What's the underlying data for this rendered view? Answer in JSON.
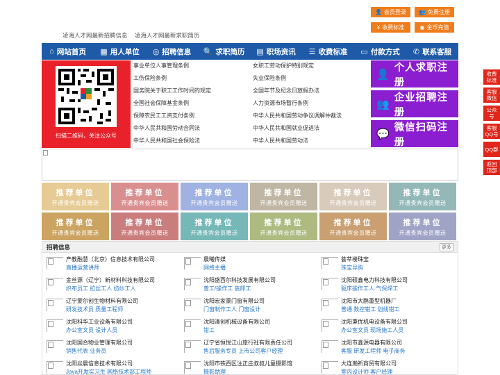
{
  "top_buttons": [
    {
      "label": "会员登录",
      "icon": "user-icon"
    },
    {
      "label": "免费注册",
      "icon": "user-add-icon"
    },
    {
      "label": "收费标准",
      "icon": "yen-icon"
    },
    {
      "label": "金币充值",
      "icon": "coin-icon"
    }
  ],
  "site_links": [
    "凌海人才网最新招聘信息",
    "凌海人才网最新求职简历"
  ],
  "nav": [
    {
      "label": "网站首页",
      "icon": "home-icon"
    },
    {
      "label": "用人单位",
      "icon": "building-icon"
    },
    {
      "label": "招聘信息",
      "icon": "recruit-icon"
    },
    {
      "label": "求职简历",
      "icon": "resume-icon"
    },
    {
      "label": "职场资讯",
      "icon": "news-icon"
    },
    {
      "label": "收费标准",
      "icon": "fee-icon"
    },
    {
      "label": "付款方式",
      "icon": "payment-icon"
    },
    {
      "label": "联系客服",
      "icon": "phone-icon"
    }
  ],
  "qr_caption": "扫描二维码，关注公众号",
  "policy_links": [
    "事业单位人事管理条例",
    "女职工劳动保护特别规定",
    "工伤保险条例",
    "失业保险条例",
    "国务院关于职工工作时间的规定",
    "全国年节及纪念日放假办法",
    "全国社会保障基金条例",
    "人力资源市场暂行条例",
    "保障农民工工资支付条例",
    "中华人民共和国劳动争议调解仲裁法",
    "中华人民共和国劳动合同法",
    "中华人民共和国就业促进法",
    "中华人民共和国社会保险法",
    "中华人民共和国劳动法"
  ],
  "register": [
    {
      "label": "个人求职注册",
      "icon": "person-icon"
    },
    {
      "label": "企业招聘注册",
      "icon": "company-icon"
    },
    {
      "label": "微信扫码注册",
      "icon": "wechat-icon"
    }
  ],
  "recommend": {
    "title": "推荐单位",
    "subtitle": "开通贵宾会员赠送",
    "colors": [
      "#e6c98f",
      "#d78a8a",
      "#9aaee0",
      "#bdb3a0",
      "#d7c9b8",
      "#8fb5b5",
      "#c9a05a",
      "#c87777",
      "#6fb4b4",
      "#a9b87a",
      "#c89a6a",
      "#9aa0c4"
    ]
  },
  "jobs": {
    "title": "招聘信息",
    "more": "更多",
    "items": [
      {
        "company": "产教融慧（北京）信息技术有限公司",
        "positions": "直播运营讲师"
      },
      {
        "company": "晨曦传媒",
        "positions": "网络主播"
      },
      {
        "company": "荟萃楼珠宝",
        "positions": "珠宝导购"
      },
      {
        "company": "金丝源（辽宁）新材料科技有限公司",
        "positions": "织布员工 拉丝工人 纺纱工人"
      },
      {
        "company": "沈阳盛西尔科技发展有限公司",
        "positions": "普工/操作工 装卸工"
      },
      {
        "company": "沈阳硕鑫电力科技有限公司",
        "positions": "驱床操作工人 气保焊工"
      },
      {
        "company": "辽宁爱尔创生物材料有限公司",
        "positions": "研发技术员 质量工程师"
      },
      {
        "company": "沈阳宏家豪门窗有限公司",
        "positions": "门窗制作工人 门窗设计"
      },
      {
        "company": "沈阳市大鹏重型机器厂",
        "positions": "普通 数控钳工 划线钳工"
      },
      {
        "company": "沈阳科华工业设备有限公司",
        "positions": "办公室文员 设计人员"
      },
      {
        "company": "沈阳清创机械设备有限公司",
        "positions": "钳工"
      },
      {
        "company": "沈阳秉优机电设备有限公司",
        "positions": "办公室文员 现场施工人员"
      },
      {
        "company": "沈阳国合物业管理有限公司",
        "positions": "销售代表 业务员"
      },
      {
        "company": "辽宁省恒悦江山旅行社有限责任公司",
        "positions": "售后服务专员 上市公司客户经理"
      },
      {
        "company": "沈阳市鑫源电器有限公司",
        "positions": "客服 研发工程师 电子商务"
      },
      {
        "company": "沈阳焱晨信息技术有限公司",
        "positions": "Java开发实习生 网络技术部工程师"
      },
      {
        "company": "沈阳市铁西区注正庄叔叔儿童摄影馆",
        "positions": "摄影助理"
      },
      {
        "company": "大连瀚祈商贸有限公司",
        "positions": "室内设计师 客户经理"
      }
    ]
  },
  "side_buttons": [
    "收费标准",
    "客服微信",
    "公众号",
    "客服QQ号",
    "QQ群",
    "返回顶部"
  ]
}
